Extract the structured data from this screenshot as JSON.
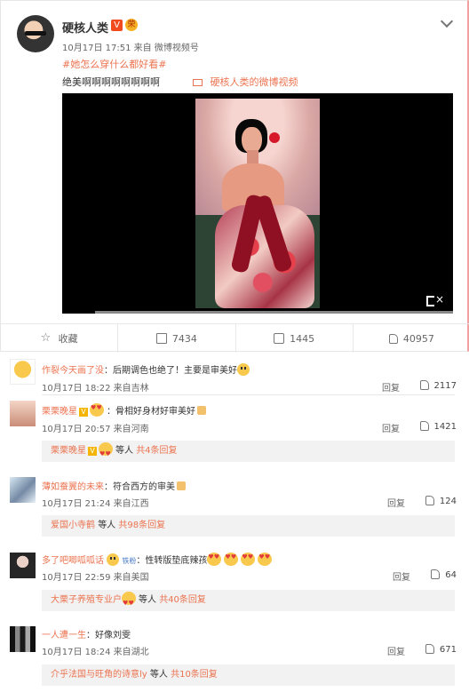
{
  "post": {
    "author": "硬核人类",
    "verified_badge": "V",
    "medal_badge": "荣",
    "time": "10月17日 17:51",
    "source": "来自 微博视频号",
    "hashtag": "#她怎么穿什么都好看#",
    "text": "绝美啊啊啊啊啊啊啊啊",
    "video_link": "硬核人类的微博视频",
    "icons": [
      "chevron-down-icon",
      "video-icon",
      "mute-icon",
      "favorite-icon",
      "forward-icon",
      "comment-icon",
      "like-icon"
    ],
    "actions": [
      {
        "label": "收藏",
        "icon": "favorite-icon"
      },
      {
        "label": "7434",
        "icon": "forward-icon"
      },
      {
        "label": "1445",
        "icon": "comment-icon"
      },
      {
        "label": "40957",
        "icon": "like-icon"
      }
    ]
  },
  "comments": [
    {
      "author": "作裂今天画了没",
      "text": "：后期调色也绝了！主要是审美好",
      "time": "10月17日 18:22 来自吉林",
      "reply": "回复",
      "likes": "2117"
    },
    {
      "author": "栗栗晚星",
      "text": "：骨相好身材好审美好",
      "time": "10月17日 20:57 来自河南",
      "reply": "回复",
      "likes": "1421",
      "subreply": {
        "author": "栗栗晚星",
        "text": "等人",
        "count": "共4条回复"
      }
    },
    {
      "author": "薄如蚕翼的未来",
      "text": "：符合西方的审美",
      "time": "10月17日 21:24 来自江西",
      "reply": "回复",
      "likes": "124",
      "subreply": {
        "author": "爱国小寺鹤",
        "text": "等人",
        "count": "共98条回复"
      }
    },
    {
      "author": "多了吧唧呱呱话",
      "badge": "铁粉",
      "text": "：性转版垫底辣孩",
      "time": "10月17日 22:59 来自美国",
      "reply": "回复",
      "likes": "64",
      "subreply": {
        "author": "大栗子养殖专业户",
        "text": "等人",
        "count": "共40条回复"
      }
    },
    {
      "author": "一人遭一生",
      "text": "：好像刘雯",
      "time": "10月17日 18:24 来自湖北",
      "reply": "回复",
      "likes": "671",
      "subreply": {
        "author": "介乎法国与旺角的诗意ly",
        "text": "等人",
        "count": "共10条回复"
      }
    }
  ]
}
